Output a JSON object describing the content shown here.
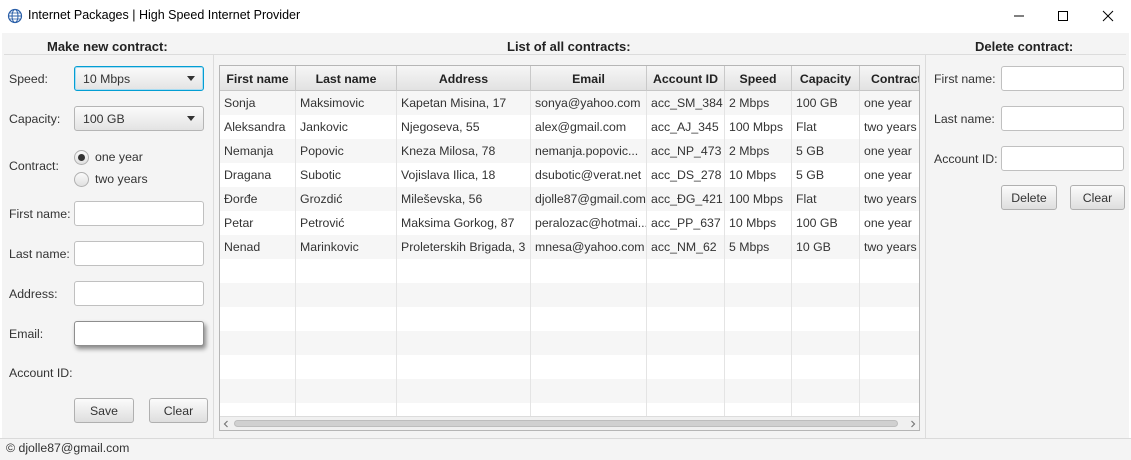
{
  "window": {
    "title": "Internet Packages | High Speed Internet Provider",
    "app_icon": "globe-icon",
    "controls": [
      "minimize-icon",
      "maximize-icon",
      "close-icon"
    ]
  },
  "new_contract": {
    "title": "Make new contract:",
    "speed_label": "Speed:",
    "speed_value": "10 Mbps",
    "capacity_label": "Capacity:",
    "capacity_value": "100 GB",
    "contract_label": "Contract:",
    "contract_options": [
      {
        "label": "one year",
        "selected": true
      },
      {
        "label": "two years",
        "selected": false
      }
    ],
    "first_name_label": "First name:",
    "first_name_value": "",
    "last_name_label": "Last name:",
    "last_name_value": "",
    "address_label": "Address:",
    "address_value": "",
    "email_label": "Email:",
    "email_value": "",
    "account_id_label": "Account ID:",
    "save_label": "Save",
    "clear_label": "Clear"
  },
  "contracts": {
    "title": "List of all contracts:",
    "columns": [
      "First name",
      "Last name",
      "Address",
      "Email",
      "Account ID",
      "Speed",
      "Capacity",
      "Contract"
    ],
    "rows": [
      [
        "Sonja",
        "Maksimovic",
        "Kapetan Misina, 17",
        "sonya@yahoo.com",
        "acc_SM_384",
        "2 Mbps",
        "100 GB",
        "one year"
      ],
      [
        "Aleksandra",
        "Jankovic",
        "Njegoseva, 55",
        "alex@gmail.com",
        "acc_AJ_345",
        "100 Mbps",
        "Flat",
        "two years"
      ],
      [
        "Nemanja",
        "Popovic",
        "Kneza Milosa, 78",
        "nemanja.popovic...",
        "acc_NP_473",
        "2 Mbps",
        "5 GB",
        "one year"
      ],
      [
        "Dragana",
        "Subotic",
        "Vojislava Ilica, 18",
        "dsubotic@verat.net",
        "acc_DS_278",
        "10 Mbps",
        "5 GB",
        "one year"
      ],
      [
        "Đorđe",
        "Grozdić",
        "Mileševska, 56",
        "djolle87@gmail.com",
        "acc_ĐG_421",
        "100 Mbps",
        "Flat",
        "two years"
      ],
      [
        "Petar",
        "Petrović",
        "Maksima Gorkog, 87",
        "peralozac@hotmai...",
        "acc_PP_637",
        "10 Mbps",
        "100 GB",
        "one year"
      ],
      [
        "Nenad",
        "Marinkovic",
        "Proleterskih Brigada, 3",
        "mnesa@yahoo.com",
        "acc_NM_62",
        "5 Mbps",
        "10 GB",
        "two years"
      ]
    ],
    "scroll_left_icon": "chevron-left-icon",
    "scroll_right_icon": "chevron-right-icon"
  },
  "delete_contract": {
    "title": "Delete contract:",
    "first_name_label": "First name:",
    "first_name_value": "",
    "last_name_label": "Last name:",
    "last_name_value": "",
    "account_id_label": "Account ID:",
    "account_id_value": "",
    "delete_label": "Delete",
    "clear_label": "Clear"
  },
  "status": {
    "text": "© djolle87@gmail.com"
  },
  "colors": {
    "focus_blue": "#039ed3",
    "panel_bg": "#f4f4f4",
    "row_alt": "#f6f6f6"
  }
}
